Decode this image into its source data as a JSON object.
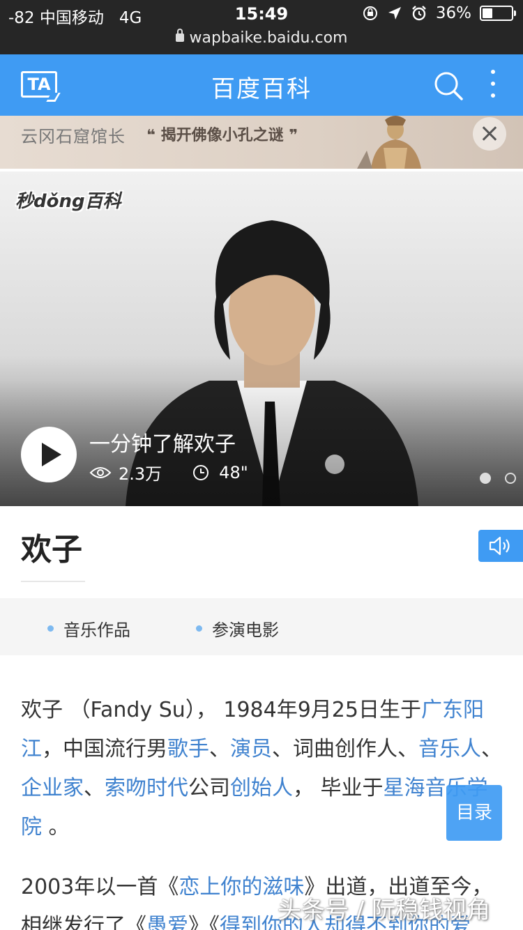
{
  "status_bar": {
    "signal": "-82",
    "carrier": "中国移动",
    "network": "4G",
    "time": "15:49",
    "battery": "36%",
    "battery_level": 0.36,
    "url": "wapbaike.baidu.com"
  },
  "header": {
    "logo": "TA",
    "title": "百度百科",
    "accent_color": "#3f9bf3"
  },
  "banner": {
    "label": "云冈石窟馆长",
    "quote_open": "❝",
    "quote": "揭开佛像小孔之谜",
    "quote_close": "❞"
  },
  "video": {
    "brand": "秒dǒng百科",
    "title": "一分钟了解欢子",
    "views": "2.3万",
    "duration": "48\"",
    "slide_count": 2,
    "active_slide": 1
  },
  "entry": {
    "title": "欢子"
  },
  "tabs": [
    {
      "label": "音乐作品"
    },
    {
      "label": "参演电影"
    }
  ],
  "article": {
    "p1": [
      {
        "t": "欢子 （Fandy Su）， 1984年9月25日生于"
      },
      {
        "t": "广东阳江",
        "link": true
      },
      {
        "t": "，中国流行男"
      },
      {
        "t": "歌手",
        "link": true
      },
      {
        "t": "、"
      },
      {
        "t": "演员",
        "link": true
      },
      {
        "t": "、词曲创作人、"
      },
      {
        "t": "音乐人",
        "link": true
      },
      {
        "t": "、"
      },
      {
        "t": "企业家",
        "link": true
      },
      {
        "t": "、"
      },
      {
        "t": "索吻时代",
        "link": true
      },
      {
        "t": "公司"
      },
      {
        "t": "创始人",
        "link": true
      },
      {
        "t": "， 毕业于"
      },
      {
        "t": "星海音乐学院",
        "link": true
      },
      {
        "t": " 。"
      }
    ],
    "p2": [
      {
        "t": "2003年以一首《"
      },
      {
        "t": "恋上你的滋味",
        "link": true
      },
      {
        "t": "》出道，出道至今，相继发行了《"
      },
      {
        "t": "愚爱",
        "link": true
      },
      {
        "t": "》《"
      },
      {
        "t": "得到你的人却得不到你的爱",
        "link": true
      }
    ]
  },
  "toc_button": "目录",
  "watermark": "头条号 / 阮稳钱视角"
}
